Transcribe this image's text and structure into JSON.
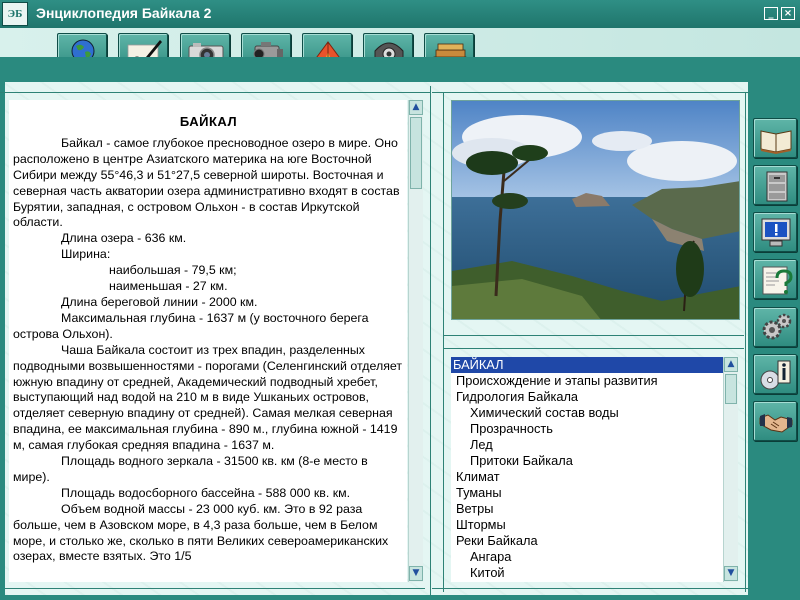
{
  "app": {
    "logo_text": "ЭБ",
    "title": "Энциклопедия Байкала 2",
    "minimize_label": "_",
    "close_label": "×"
  },
  "toolbar": {
    "buttons": [
      {
        "name": "encyclopedia-globe-button",
        "icon": "globe-icon"
      },
      {
        "name": "writing-button",
        "icon": "pen-writing-icon"
      },
      {
        "name": "photo-button",
        "icon": "photo-camera-icon"
      },
      {
        "name": "video-button",
        "icon": "video-camera-icon"
      },
      {
        "name": "tourism-button",
        "icon": "tent-icon"
      },
      {
        "name": "panorama-button",
        "icon": "panorama-camera-icon"
      },
      {
        "name": "books-button",
        "icon": "books-icon"
      }
    ]
  },
  "article": {
    "heading": "БАЙКАЛ",
    "paragraphs": [
      {
        "style": "ind1",
        "text": "Байкал - самое глубокое пресноводное озеро в мире. Оно расположено в центре Азиатского материка на юге Восточной Сибири между 55°46,3 и 51°27,5 северной широты. Восточная и северная часть акватории озера административно входят в состав Бурятии, западная, с островом Ольхон - в состав Иркутской области."
      },
      {
        "style": "ind2",
        "text": "Длина озера - 636 км."
      },
      {
        "style": "ind2",
        "text": "Ширина:"
      },
      {
        "style": "ind3",
        "text": "наибольшая - 79,5 км;"
      },
      {
        "style": "ind3",
        "text": "наименьшая - 27 км."
      },
      {
        "style": "ind2",
        "text": "Длина береговой линии - 2000 км."
      },
      {
        "style": "ind1",
        "text": "Максимальная глубина - 1637 м (у восточного берега острова Ольхон)."
      },
      {
        "style": "ind1",
        "text": "Чаша Байкала состоит из трех впадин, разделенных подводными возвышенностями - порогами (Селенгинский отделяет южную впадину от средней, Академический подводный хребет, выступающий над водой на 210 м в виде Ушканьих островов, отделяет северную впадину от средней). Самая мелкая северная впадина, ее максимальная глубина - 890 м., глубина южной - 1419 м, самая глубокая средняя впадина - 1637 м."
      },
      {
        "style": "ind1",
        "text": "Площадь водного зеркала - 31500 кв. км (8-е место в мире)."
      },
      {
        "style": "ind1",
        "text": "Площадь водосборного бассейна - 588 000 кв. км."
      },
      {
        "style": "ind1",
        "text": "Объем водной массы - 23 000 куб. км. Это в 92 раза больше, чем в Азовском море, в 4,3 раза больше, чем в Белом море, и столько же, сколько в пяти Великих североамериканских озерах, вместе взятых. Это 1/5"
      }
    ]
  },
  "scroll": {
    "up": "▲",
    "down": "▼"
  },
  "topics": [
    {
      "label": "БАЙКАЛ",
      "level": 0,
      "selected": true
    },
    {
      "label": "Происхождение и этапы развития",
      "level": 0
    },
    {
      "label": "Гидрология Байкала",
      "level": 0
    },
    {
      "label": "Химический состав воды",
      "level": 1
    },
    {
      "label": "Прозрачность",
      "level": 1
    },
    {
      "label": "Лед",
      "level": 1
    },
    {
      "label": "Притоки Байкала",
      "level": 1
    },
    {
      "label": "Климат",
      "level": 0
    },
    {
      "label": "Туманы",
      "level": 0
    },
    {
      "label": "Ветры",
      "level": 0
    },
    {
      "label": "Штормы",
      "level": 0
    },
    {
      "label": "Реки Байкала",
      "level": 0
    },
    {
      "label": "Ангара",
      "level": 1
    },
    {
      "label": "Китой",
      "level": 1
    }
  ],
  "side_buttons": [
    {
      "name": "book-button",
      "icon": "open-book-icon"
    },
    {
      "name": "archive-button",
      "icon": "filing-cabinet-icon"
    },
    {
      "name": "monitor-button",
      "icon": "monitor-alert-icon"
    },
    {
      "name": "help-button",
      "icon": "help-question-icon"
    },
    {
      "name": "settings-button",
      "icon": "gears-icon"
    },
    {
      "name": "info-button",
      "icon": "info-cd-icon"
    },
    {
      "name": "exit-button",
      "icon": "handshake-icon"
    }
  ],
  "colors": {
    "frame": "#2a8a7f",
    "titlebar": "#1f756c",
    "selection": "#1f48a8"
  }
}
